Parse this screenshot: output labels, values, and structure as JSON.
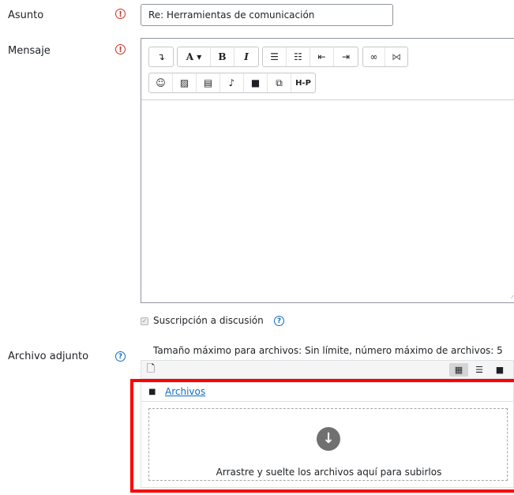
{
  "form": {
    "subject": {
      "label": "Asunto",
      "value": "Re: Herramientas de comunicación"
    },
    "message": {
      "label": "Mensaje"
    },
    "subscription": {
      "label": "Suscripción a discusión"
    },
    "attachment": {
      "label": "Archivo adjunto",
      "limit_text": "Tamaño máximo para archivos: Sin límite, número máximo de archivos: 5",
      "folder_link": "Archivos",
      "drop_text": "Arrastre y suelte los archivos aquí para subirlos"
    }
  },
  "icons": {
    "required": "!",
    "help": "?",
    "toolbar_row1": [
      "collapse-icon",
      "font-color-icon",
      "bold-icon",
      "italic-icon",
      "unordered-list-icon",
      "ordered-list-icon",
      "outdent-icon",
      "indent-icon",
      "link-icon",
      "unlink-icon"
    ],
    "toolbar_row2": [
      "emoji-icon",
      "image-icon",
      "media-icon",
      "record-audio-icon",
      "record-video-icon",
      "manage-files-icon",
      "h5p-icon"
    ]
  },
  "toolbar": {
    "font_color": "A ▾",
    "bold": "B",
    "italic": "I",
    "h5p": "H-P"
  },
  "colors": {
    "required": "#ca3120",
    "help": "#0f6cbf",
    "highlight_border": "#ff0000",
    "link": "#0f6cbf"
  }
}
